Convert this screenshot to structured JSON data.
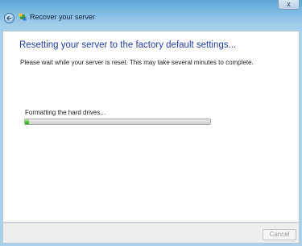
{
  "window": {
    "title": "Recover your server",
    "close_label": "x"
  },
  "page": {
    "heading": "Resetting your server to the factory default settings...",
    "description": "Please wait while your server is reset. This may take several minutes to complete.",
    "status": "Formatting the hard drives...",
    "progress_percent": 2
  },
  "footer": {
    "cancel_label": "Cancel",
    "cancel_enabled": false
  },
  "colors": {
    "heading": "#1f3fa3",
    "progress_fill": "#45c92e"
  },
  "icons": {
    "back": "back-arrow-icon",
    "app": "server-recovery-icon",
    "close": "close-icon"
  }
}
